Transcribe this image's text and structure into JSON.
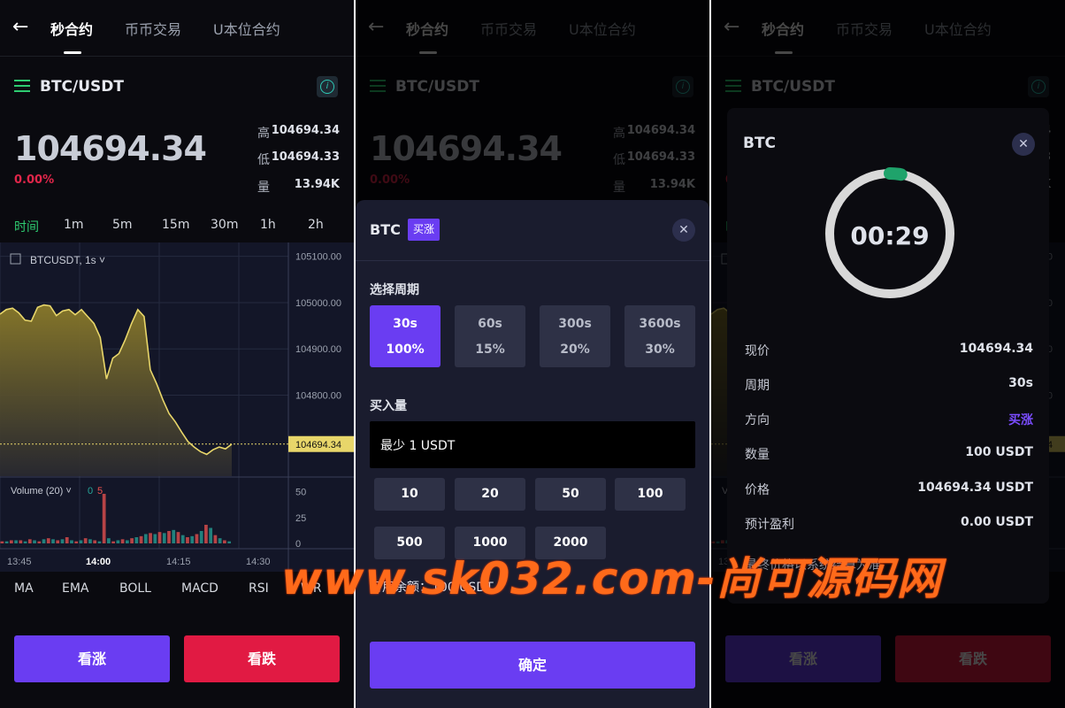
{
  "nav": {
    "back_icon": "arrow-left-icon",
    "tabs": [
      "秒合约",
      "币币交易",
      "U本位合约"
    ]
  },
  "pair": "BTC/USDT",
  "price": "104694.34",
  "change": "0.00%",
  "stats": [
    {
      "label": "高",
      "value": "104694.34"
    },
    {
      "label": "低",
      "value": "104694.33"
    },
    {
      "label": "量",
      "value": "13.94K"
    }
  ],
  "timeframes": [
    "时间",
    "1m",
    "5m",
    "15m",
    "30m",
    "1h",
    "2h"
  ],
  "chart_data": {
    "type": "area",
    "title": "BTCUSDT, 1s",
    "yticks": [
      "105100.00",
      "105000.00",
      "104900.00",
      "104800.00"
    ],
    "last_price_label": "104694.34",
    "xticks": [
      "13:45",
      "14:00",
      "14:15",
      "14:30"
    ],
    "ylim": [
      104625,
      105130
    ],
    "y": [
      104975,
      104985,
      104988,
      104978,
      104962,
      104960,
      104990,
      104995,
      104993,
      104972,
      104982,
      104985,
      104974,
      104985,
      104970,
      104955,
      104925,
      104835,
      104880,
      104890,
      104920,
      104955,
      104985,
      104970,
      104855,
      104825,
      104790,
      104760,
      104742,
      104720,
      104700,
      104688,
      104678,
      104672,
      104682,
      104688,
      104684,
      104694
    ],
    "volume": {
      "label": "Volume (20)",
      "readout": [
        "0",
        "5"
      ],
      "yticks": [
        "50",
        "25",
        "0"
      ],
      "values": [
        2,
        2,
        3,
        3,
        3,
        2,
        4,
        3,
        2,
        4,
        5,
        4,
        3,
        4,
        6,
        3,
        2,
        3,
        5,
        4,
        3,
        2,
        48,
        5,
        2,
        3,
        4,
        3,
        5,
        6,
        7,
        9,
        10,
        9,
        11,
        10,
        12,
        13,
        11,
        8,
        6,
        7,
        9,
        12,
        18,
        15,
        8,
        5,
        3,
        2
      ],
      "colors": [
        "#ef5350",
        "#26a69a"
      ]
    }
  },
  "indicators": [
    "MA",
    "EMA",
    "BOLL",
    "MACD",
    "RSI",
    "WR"
  ],
  "actions": {
    "up": "看涨",
    "down": "看跌"
  },
  "order_sheet": {
    "title": "BTC",
    "direction_tag": "买涨",
    "period_label": "选择周期",
    "periods": [
      {
        "time": "30s",
        "rate": "100%"
      },
      {
        "time": "60s",
        "rate": "15%"
      },
      {
        "time": "300s",
        "rate": "20%"
      },
      {
        "time": "3600s",
        "rate": "30%"
      }
    ],
    "amount_label": "买入量",
    "amount_placeholder": "最少 1 USDT",
    "amounts": [
      "10",
      "20",
      "50",
      "100",
      "500",
      "1000",
      "2000"
    ],
    "available": "可用余额：100 USDT",
    "confirm": "确定"
  },
  "result_modal": {
    "title": "BTC",
    "countdown": "00:29",
    "countdown_progress": 0.03,
    "rows": [
      {
        "label": "现价",
        "value": "104694.34"
      },
      {
        "label": "周期",
        "value": "30s"
      },
      {
        "label": "方向",
        "value": "买涨"
      },
      {
        "label": "数量",
        "value": "100 USDT"
      },
      {
        "label": "价格",
        "value": "104694.34 USDT"
      },
      {
        "label": "预计盈利",
        "value": "0.00 USDT"
      }
    ],
    "note": "最终价格以系统结算为准"
  },
  "watermark": "www.sk032.com-尚可源码网",
  "colors": {
    "accent": "#6a3df2",
    "up": "#2ecc71",
    "down": "#e11a43",
    "chart_fill": "#c9b23c"
  }
}
